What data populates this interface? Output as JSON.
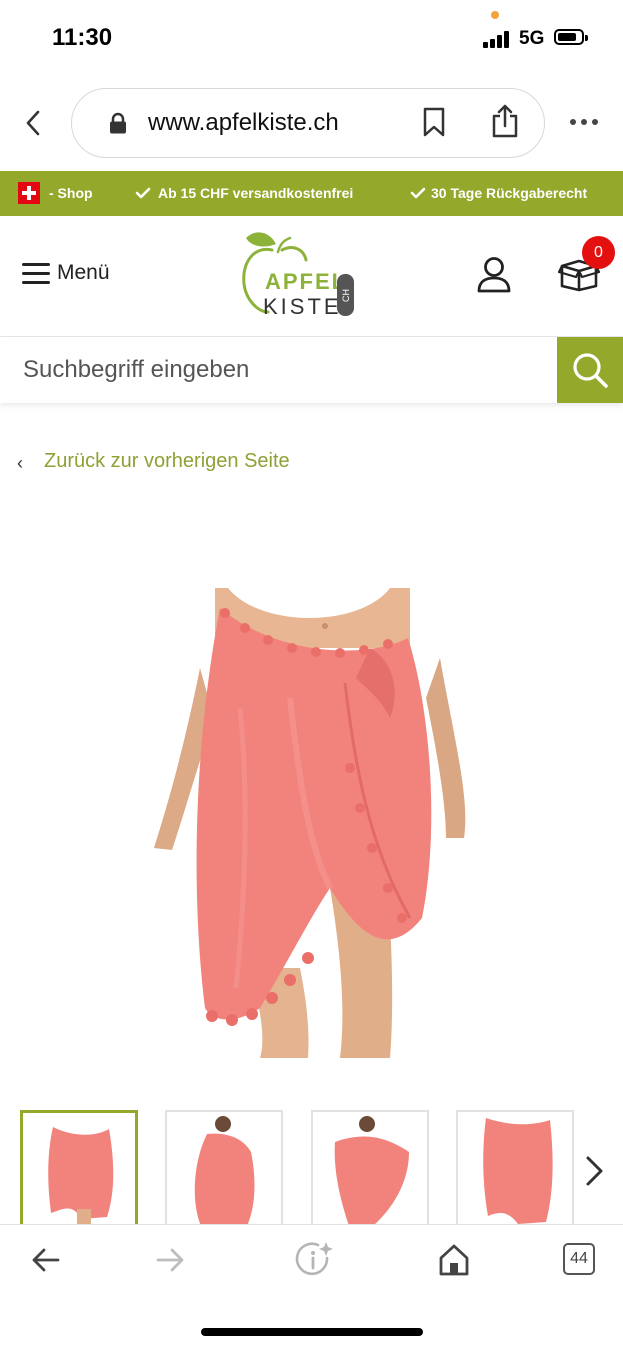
{
  "status_bar": {
    "time": "11:30",
    "network": "5G"
  },
  "browser": {
    "url": "www.apfelkiste.ch",
    "tab_count": "44"
  },
  "promo": {
    "shop": "- Shop",
    "free_shipping": "Ab 15 CHF versandkostenfrei",
    "returns": "30 Tage Rückgaberecht"
  },
  "header": {
    "menu_label": "Menü",
    "logo_line1": "APFEL",
    "logo_line2": "KISTE",
    "logo_tag": "CH",
    "cart_count": "0"
  },
  "search": {
    "placeholder": "Suchbegriff eingeben"
  },
  "breadcrumb": {
    "back_label": "Zurück zur vorherigen Seite"
  },
  "colors": {
    "brand_green": "#94a82c",
    "link_green": "#8ea134",
    "badge_red": "#e3100f",
    "product_coral": "#f2837c"
  },
  "icons": [
    "back-chevron-icon",
    "lock-icon",
    "bookmark-icon",
    "share-icon",
    "more-icon",
    "check-icon",
    "hamburger-icon",
    "user-icon",
    "cart-box-icon",
    "search-icon",
    "chevron-right-icon",
    "arrow-left-icon",
    "arrow-right-icon",
    "info-sparkle-icon",
    "home-icon",
    "tabs-icon"
  ]
}
